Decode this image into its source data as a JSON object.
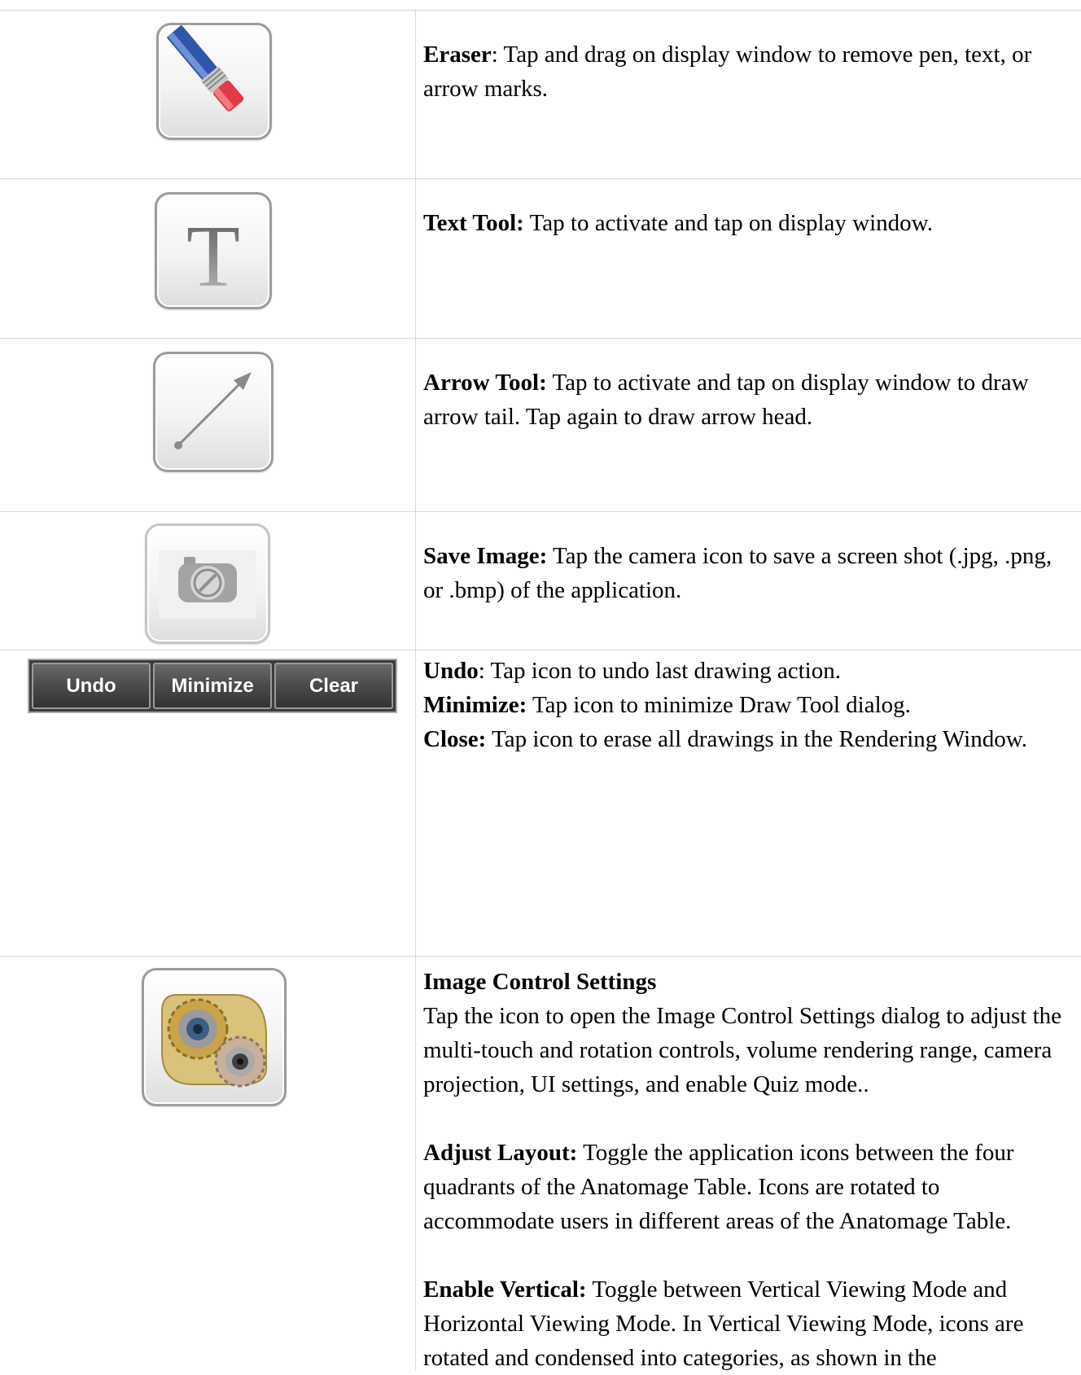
{
  "rows": [
    {
      "icon": "eraser-icon",
      "title": "Eraser",
      "title_suffix": ":",
      "text": " Tap and drag on display window to remove pen, text, or arrow marks."
    },
    {
      "icon": "text-tool-icon",
      "glyph": "T",
      "title": "Text Tool:",
      "text": " Tap to activate and tap on display window."
    },
    {
      "icon": "arrow-tool-icon",
      "title": "Arrow Tool:",
      "text": " Tap to activate and tap on display window to draw arrow tail.  Tap again to draw arrow head."
    },
    {
      "icon": "camera-icon",
      "title": "Save Image:",
      "text": " Tap the camera icon to save a screen shot (.jpg, .png, or .bmp) of the application."
    },
    {
      "buttons": [
        "Undo",
        "Minimize",
        "Clear"
      ],
      "lines": [
        {
          "title": "Undo",
          "text": ": Tap icon to undo last drawing action."
        },
        {
          "title": "Minimize:",
          "text": "  Tap icon to minimize Draw Tool dialog."
        },
        {
          "title": "Close:",
          "text": " Tap icon to erase all drawings in the Rendering Window."
        }
      ]
    },
    {
      "icon": "gears-icon",
      "heading": "Image Control Settings",
      "intro": "Tap the icon to open the Image Control Settings dialog to adjust the multi-touch and rotation controls, volume rendering range, camera projection, UI settings, and enable Quiz mode..",
      "sections": [
        {
          "title": "Adjust Layout:",
          "text": " Toggle the application icons between the four quadrants of the Anatomage Table. Icons are rotated to accommodate users in different areas of the Anatomage Table."
        },
        {
          "title": "Enable Vertical:",
          "text": " Toggle between Vertical Viewing Mode and Horizontal Viewing Mode. In Vertical Viewing Mode, icons are rotated and condensed into categories, as shown in the"
        }
      ]
    }
  ]
}
